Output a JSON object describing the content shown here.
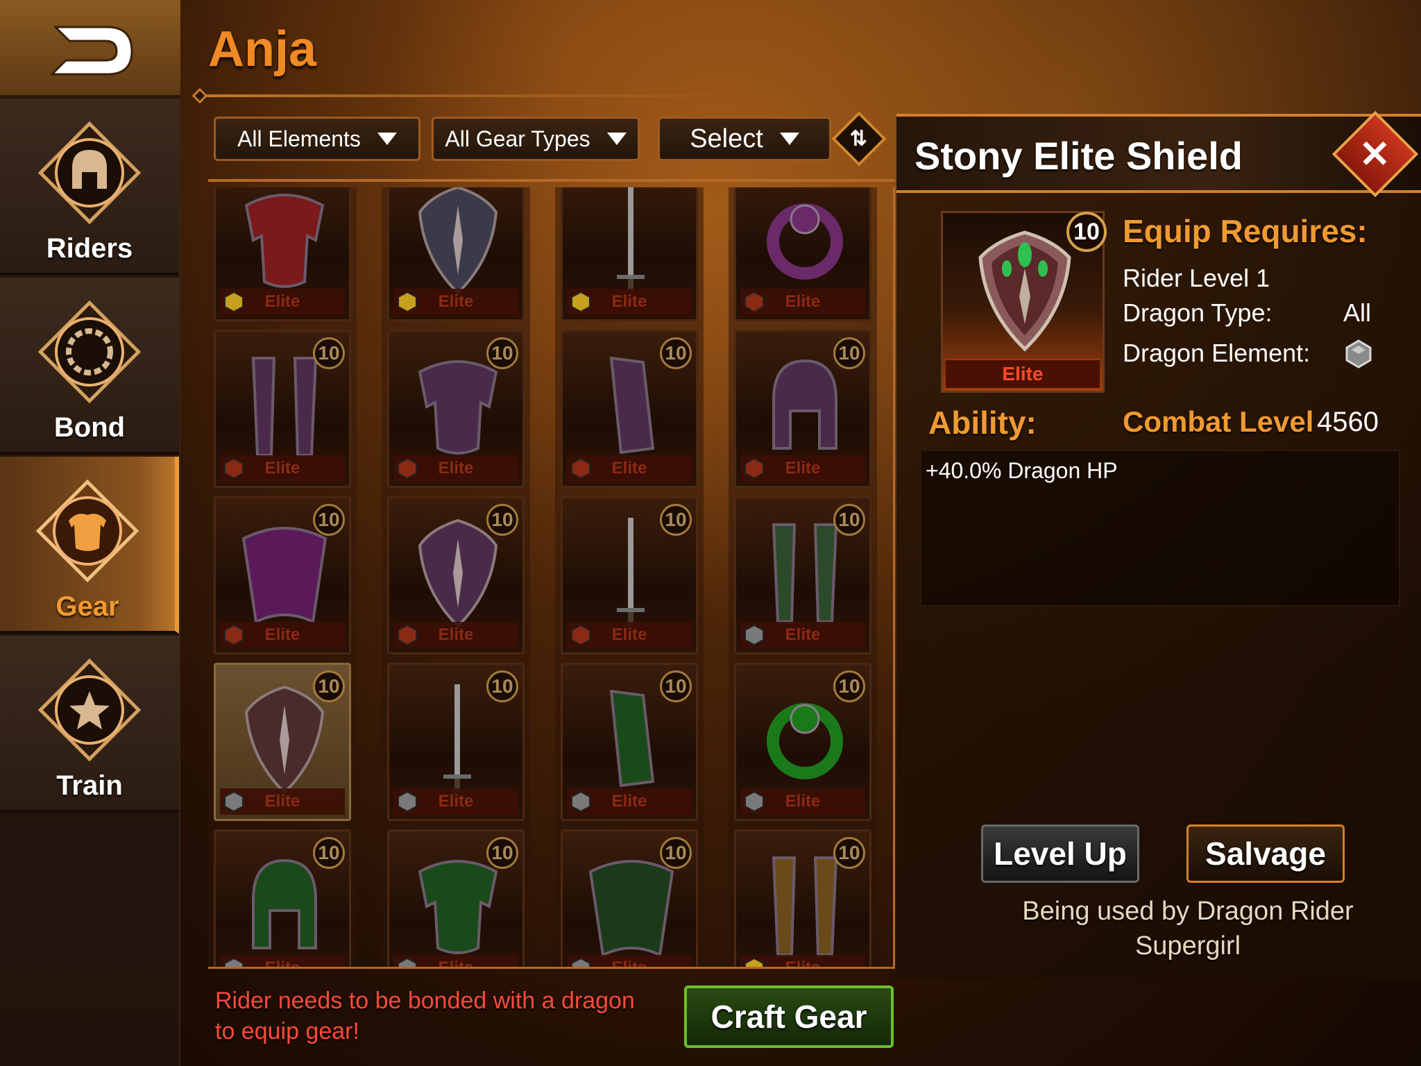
{
  "header": {
    "title": "Anja"
  },
  "sidebar": {
    "items": [
      {
        "label": "Riders",
        "icon": "helmet-icon",
        "active": false
      },
      {
        "label": "Bond",
        "icon": "chain-ring-icon",
        "active": false
      },
      {
        "label": "Gear",
        "icon": "armor-icon",
        "active": true
      },
      {
        "label": "Train",
        "icon": "star-icon",
        "active": false
      }
    ]
  },
  "filters": {
    "elements": "All Elements",
    "gear_types": "All Gear Types",
    "select": "Select"
  },
  "grid": {
    "elite_label": "Elite",
    "items": [
      {
        "kind": "chest",
        "level": null,
        "element": "gold",
        "tint": "#7a1a1a"
      },
      {
        "kind": "shield",
        "level": null,
        "element": "gold",
        "tint": "#3a3a4a"
      },
      {
        "kind": "sword",
        "level": null,
        "element": "gold",
        "tint": "#5a5a5a"
      },
      {
        "kind": "ring",
        "level": null,
        "element": "fire",
        "tint": "#6a2a6a"
      },
      {
        "kind": "legs",
        "level": "10",
        "element": "fire",
        "tint": "#4a2a4a"
      },
      {
        "kind": "chest",
        "level": "10",
        "element": "fire",
        "tint": "#4a2a4a"
      },
      {
        "kind": "gauntlet",
        "level": "10",
        "element": "fire",
        "tint": "#4a2a4a"
      },
      {
        "kind": "helm",
        "level": "10",
        "element": "fire",
        "tint": "#4a2a4a"
      },
      {
        "kind": "cape",
        "level": "10",
        "element": "fire",
        "tint": "#5a1a5a"
      },
      {
        "kind": "shield",
        "level": "10",
        "element": "fire",
        "tint": "#4a2a4a"
      },
      {
        "kind": "sword",
        "level": "10",
        "element": "fire",
        "tint": "#5a5a5a"
      },
      {
        "kind": "legs",
        "level": "10",
        "element": "stone",
        "tint": "#2a4a2a"
      },
      {
        "kind": "shield",
        "level": "10",
        "element": "stone",
        "tint": "#4a2a2a",
        "selected": true
      },
      {
        "kind": "sword",
        "level": "10",
        "element": "stone",
        "tint": "#5a5a5a"
      },
      {
        "kind": "gauntlet",
        "level": "10",
        "element": "stone",
        "tint": "#1a4a1a"
      },
      {
        "kind": "ring",
        "level": "10",
        "element": "stone",
        "tint": "#1a7a1a"
      },
      {
        "kind": "helm",
        "level": "10",
        "element": "stone",
        "tint": "#1a4a1a"
      },
      {
        "kind": "chest",
        "level": "10",
        "element": "stone",
        "tint": "#1a4a1a"
      },
      {
        "kind": "cape",
        "level": "10",
        "element": "stone",
        "tint": "#1a3a1a"
      },
      {
        "kind": "legs",
        "level": "10",
        "element": "gold",
        "tint": "#6a4a1a"
      }
    ]
  },
  "footer": {
    "warning": "Rider needs to be bonded with a dragon to equip gear!",
    "craft_label": "Craft Gear"
  },
  "detail": {
    "title": "Stony Elite Shield",
    "level": "10",
    "rarity": "Elite",
    "equip_requires_label": "Equip Requires:",
    "rider_level": "Rider Level 1",
    "dragon_type_label": "Dragon Type:",
    "dragon_type_value": "All",
    "dragon_element_label": "Dragon Element:",
    "dragon_element_icon": "stone-gem-icon",
    "ability_label": "Ability:",
    "combat_level_label": "Combat Level",
    "combat_level_value": "4560",
    "ability_text": "+40.0% Dragon HP",
    "level_up_label": "Level Up",
    "salvage_label": "Salvage",
    "used_by_line1": "Being used by Dragon Rider",
    "used_by_line2": "Supergirl"
  },
  "colors": {
    "accent": "#f08a24",
    "elite_red": "#ff4a2a",
    "warning": "#ff4a3a",
    "craft_green": "#6ac02a"
  }
}
